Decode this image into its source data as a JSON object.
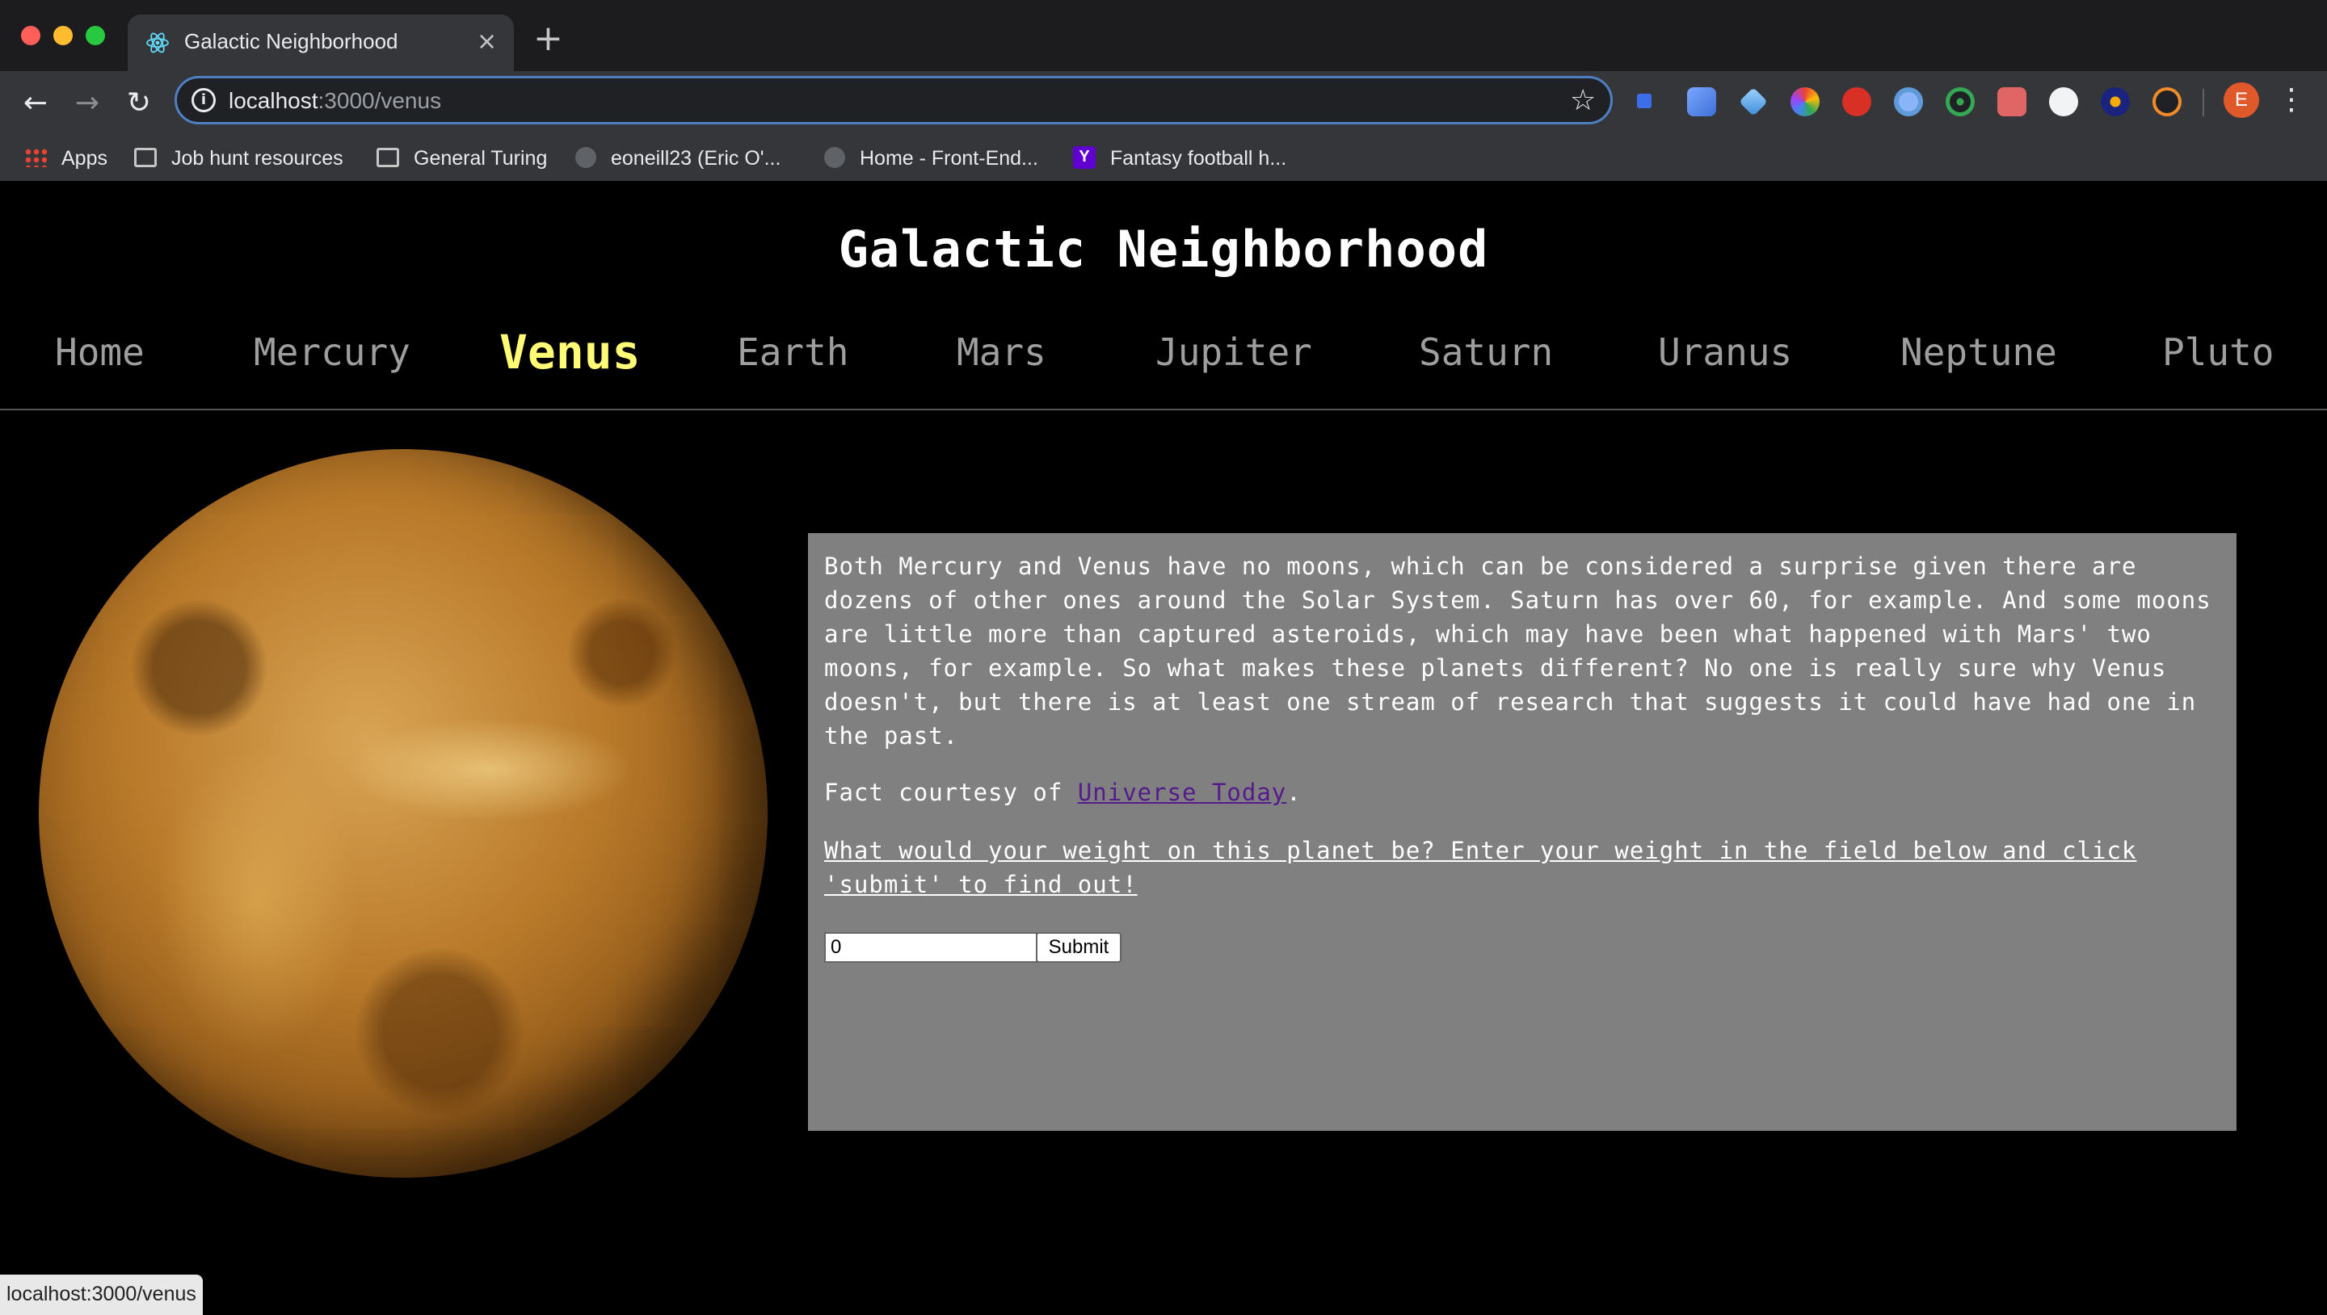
{
  "browser": {
    "tab_title": "Galactic Neighborhood",
    "tab_close": "×",
    "new_tab": "+",
    "url_host": "localhost",
    "url_path": ":3000/venus",
    "bookmarks": [
      {
        "label": "Apps",
        "icon": "apps-grid-icon"
      },
      {
        "label": "Job hunt resources",
        "icon": "folder-icon"
      },
      {
        "label": "General Turing",
        "icon": "folder-icon"
      },
      {
        "label": "eoneill23 (Eric O'...",
        "icon": "github-icon"
      },
      {
        "label": "Home - Front-End...",
        "icon": "site-icon"
      },
      {
        "label": "Fantasy football h...",
        "icon": "yahoo-icon"
      }
    ],
    "profile_initial": "E",
    "status_url": "localhost:3000/venus"
  },
  "site": {
    "title": "Galactic Neighborhood",
    "nav": [
      "Home",
      "Mercury",
      "Venus",
      "Earth",
      "Mars",
      "Jupiter",
      "Saturn",
      "Uranus",
      "Neptune",
      "Pluto"
    ],
    "active_nav": "Venus",
    "active_color": "#fffb75"
  },
  "fact": {
    "text": "Both Mercury and Venus have no moons, which can be considered a surprise given there are dozens of other ones around the Solar System. Saturn has over 60, for example. And some moons are little more than captured asteroids, which may have been what happened with Mars' two moons, for example. So what makes these planets different? No one is really sure why Venus doesn't, but there is at least one stream of research that suggests it could have had one in the past.",
    "credit_prefix": "Fact courtesy of ",
    "credit_link": "Universe Today",
    "credit_suffix": ".",
    "weight_prompt": "What would your weight on this planet be? Enter your weight in the field below and click 'submit' to find out!",
    "weight_value": "0",
    "submit_label": "Submit"
  }
}
